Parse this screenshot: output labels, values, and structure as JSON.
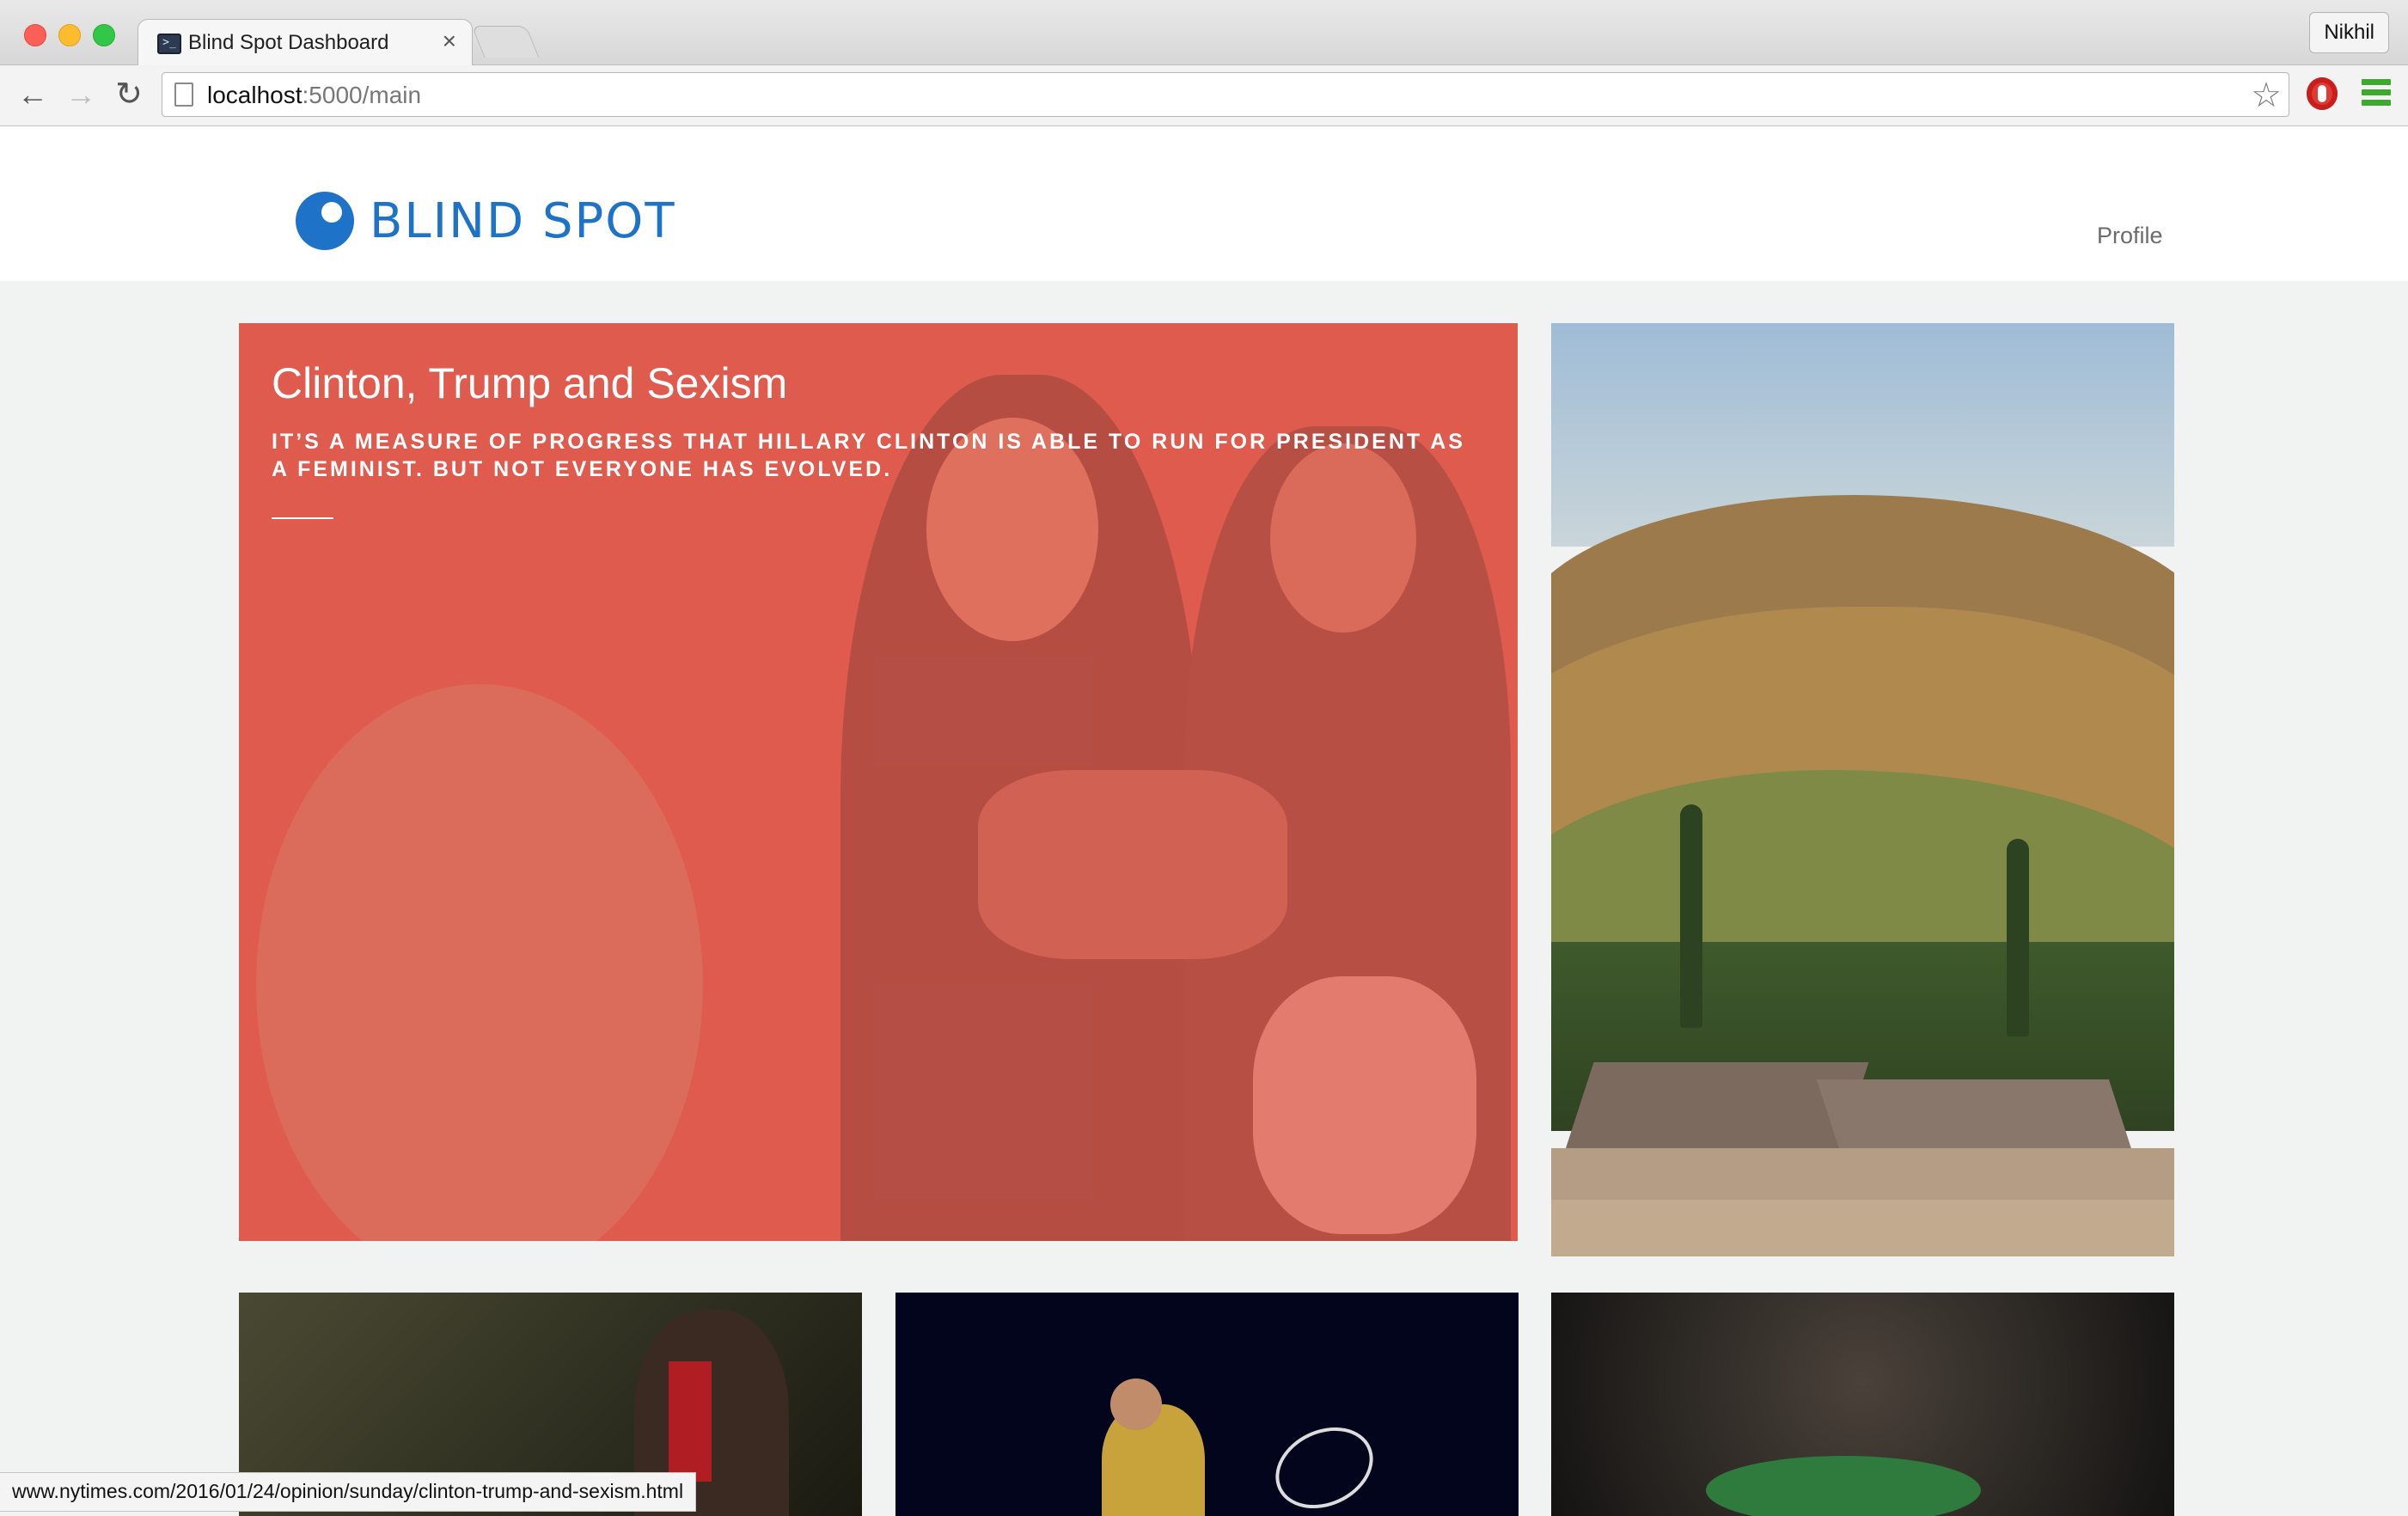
{
  "browser": {
    "tab": {
      "title": "Blind Spot Dashboard",
      "close_glyph": "×"
    },
    "profile_name": "Nikhil",
    "url": {
      "host": "localhost",
      "rest": ":5000/main"
    },
    "nav": {
      "back_glyph": "←",
      "forward_glyph": "→",
      "reload_glyph": "↻",
      "star_glyph": "☆"
    },
    "status_url": "www.nytimes.com/2016/01/24/opinion/sunday/clinton-trump-and-sexism.html"
  },
  "site": {
    "logo_text": "BLIND SPOT",
    "nav_profile": "Profile",
    "brand_color": "#1e73c8"
  },
  "feature": {
    "title": "Clinton, Trump and Sexism",
    "summary": "IT’S A MEASURE OF PROGRESS THAT HILLARY CLINTON IS ABLE TO RUN FOR PRESIDENT AS A FEMINIST. BUT NOT EVERYONE HAS EVOLVED.",
    "overlay_color": "#e05c4e"
  }
}
